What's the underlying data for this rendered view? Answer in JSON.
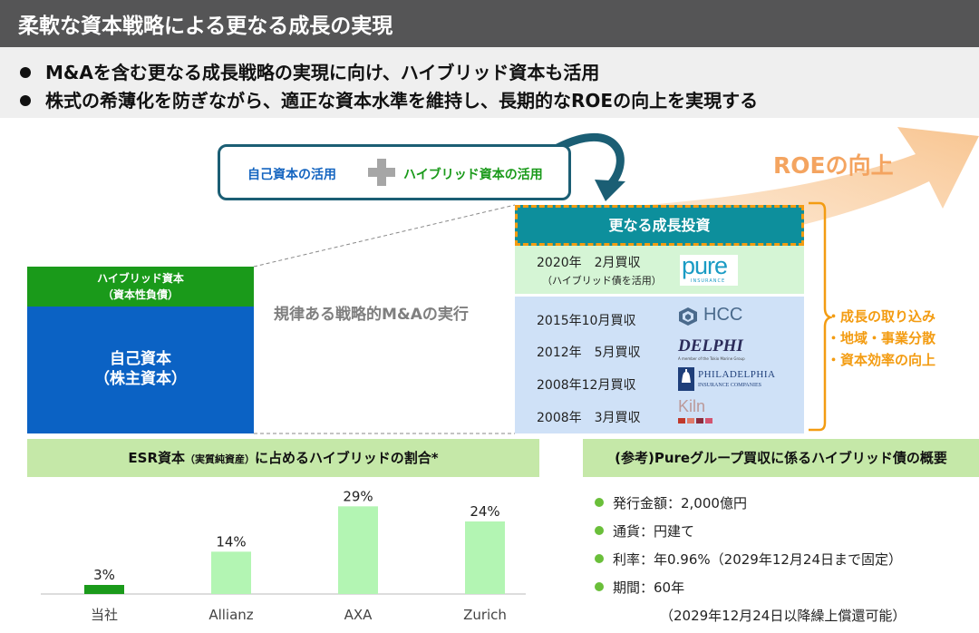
{
  "title": "柔軟な資本戦略による更なる成長の実現",
  "bullets": [
    "M&Aを含む更なる成長戦略の実現に向け、ハイブリッド資本も活用",
    "株式の希薄化を防ぎながら、適正な資本水準を維持し、長期的なROEの向上を実現する"
  ],
  "capital_box": {
    "own": "自己資本の活用",
    "hybrid": "ハイブリッド資本の活用"
  },
  "roe_label": "ROEの向上",
  "capital_structure": {
    "hybrid_line1": "ハイブリッド資本",
    "hybrid_line2": "（資本性負債）",
    "equity_line1": "自己資本",
    "equity_line2": "（株主資本）"
  },
  "ma_label": "規律ある戦略的M&Aの実行",
  "growth_investment": {
    "header": "更なる成長投資",
    "pure": {
      "date": "2020年　2月買収",
      "note": "（ハイブリッド債を活用）",
      "logo": "pure",
      "logo_sub": "INSURANCE"
    },
    "acquisitions": [
      {
        "date": "2015年10月買収",
        "logo": "HCC"
      },
      {
        "date": "2012年　5月買収",
        "logo": "DELPHI",
        "logo_sub": "A member of the Tokio Marine Group"
      },
      {
        "date": "2008年12月買収",
        "logo": "PHILADELPHIA",
        "logo_sub": "INSURANCE COMPANIES"
      },
      {
        "date": "2008年　3月買収",
        "logo": "Kiln"
      }
    ]
  },
  "benefits": [
    "・成長の取り込み",
    "・地域・事業分散",
    "・資本効率の向上"
  ],
  "esr_header": {
    "main": "ESR資本",
    "small": "（実質純資産）",
    "rest": "に占めるハイブリッドの割合*"
  },
  "chart_data": {
    "type": "bar",
    "categories": [
      "当社",
      "Allianz",
      "AXA",
      "Zurich"
    ],
    "values": [
      3,
      14,
      29,
      24
    ],
    "value_labels": [
      "3%",
      "14%",
      "29%",
      "24%"
    ],
    "unit": "%",
    "ylim": [
      0,
      30
    ],
    "colors": {
      "highlight": "#1a9a1a",
      "others": "#b3f5b3"
    },
    "title": "ESR資本（実質純資産）に占めるハイブリッドの割合*"
  },
  "reference": {
    "header": "(参考)Pureグループ買収に係るハイブリッド債の概要",
    "items": [
      "発行金額：2,000億円",
      "通貨：円建て",
      "利率：年0.96%（2029年12月24日まで固定）",
      "期間：60年"
    ],
    "note": "（2029年12月24日以降繰上償還可能）"
  },
  "colors": {
    "title_bg": "#555556",
    "accent_green": "#1a9a1a",
    "accent_blue": "#0b62c4",
    "accent_orange": "#f39c12",
    "teal": "#0d8f9c"
  }
}
